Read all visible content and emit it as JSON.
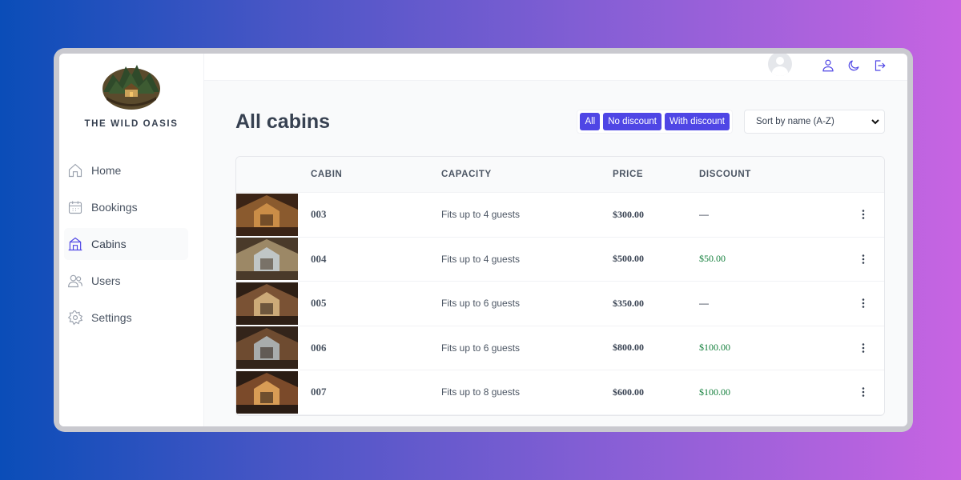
{
  "brand": {
    "name": "THE WILD OASIS"
  },
  "sidebar": {
    "items": [
      {
        "label": "Home",
        "icon": "home-icon"
      },
      {
        "label": "Bookings",
        "icon": "calendar-icon"
      },
      {
        "label": "Cabins",
        "icon": "cabin-icon",
        "active": true
      },
      {
        "label": "Users",
        "icon": "users-icon"
      },
      {
        "label": "Settings",
        "icon": "gear-icon"
      }
    ]
  },
  "header": {
    "icons": [
      "avatar",
      "user-icon",
      "moon-icon",
      "logout-icon"
    ]
  },
  "page": {
    "title": "All cabins",
    "filters": [
      "All",
      "No discount",
      "With discount"
    ],
    "sort": {
      "selected": "Sort by name (A-Z)"
    }
  },
  "table": {
    "columns": [
      "CABIN",
      "CAPACITY",
      "PRICE",
      "DISCOUNT"
    ],
    "rows": [
      {
        "name": "003",
        "capacity": "Fits up to 4 guests",
        "price": "$300.00",
        "discount": "—"
      },
      {
        "name": "004",
        "capacity": "Fits up to 4 guests",
        "price": "$500.00",
        "discount": "$50.00"
      },
      {
        "name": "005",
        "capacity": "Fits up to 6 guests",
        "price": "$350.00",
        "discount": "—"
      },
      {
        "name": "006",
        "capacity": "Fits up to 6 guests",
        "price": "$800.00",
        "discount": "$100.00"
      },
      {
        "name": "007",
        "capacity": "Fits up to 8 guests",
        "price": "$600.00",
        "discount": "$100.00"
      }
    ]
  },
  "colors": {
    "accent": "#4f46e5",
    "discount": "#15803d"
  }
}
